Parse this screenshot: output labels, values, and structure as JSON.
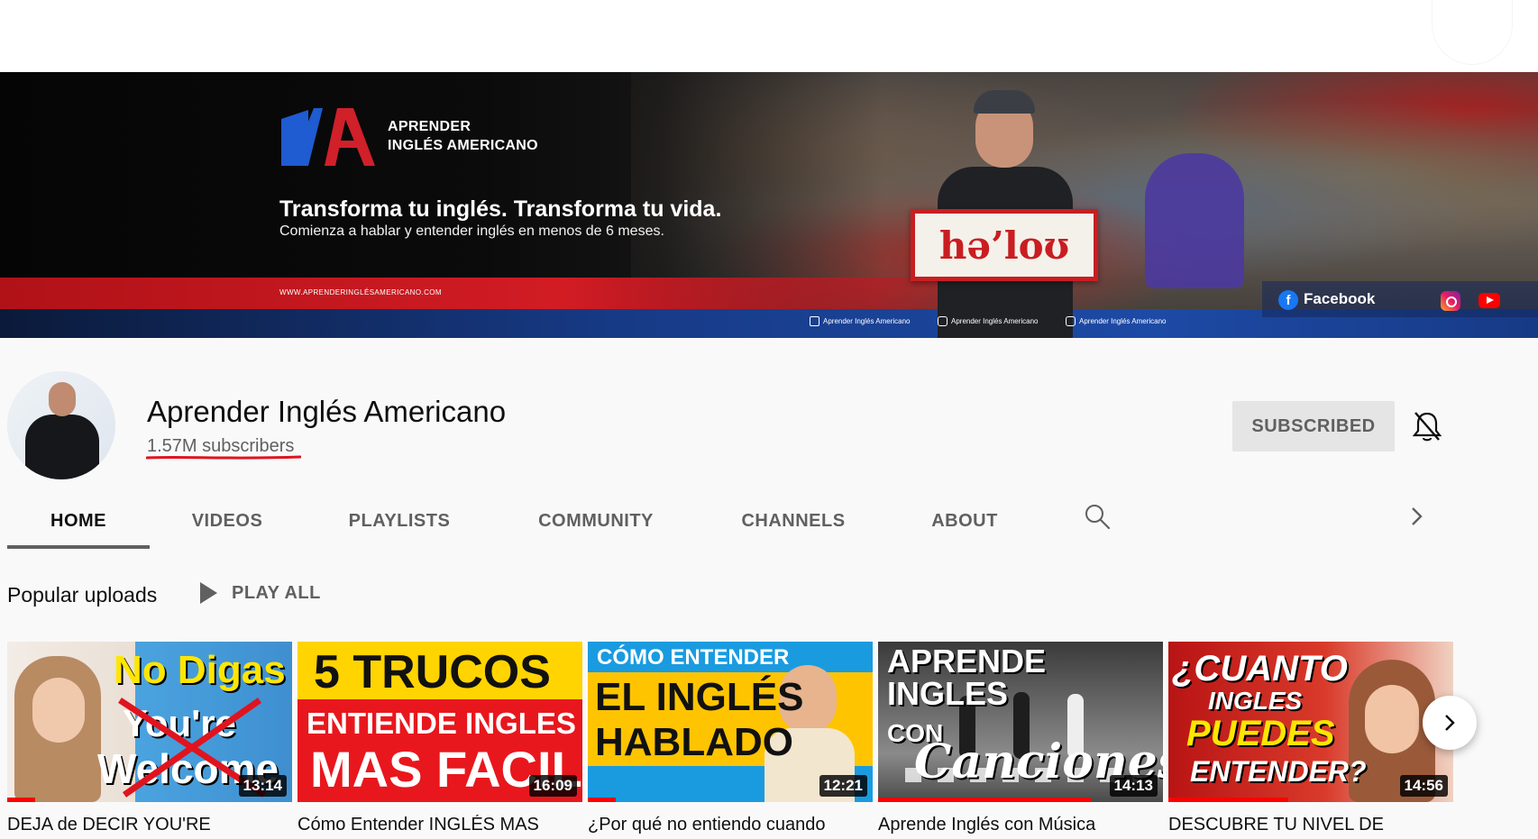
{
  "banner": {
    "logo_line1": "APRENDER",
    "logo_line2": "INGLÉS AMERICANO",
    "headline": "Transforma tu inglés. Transforma tu vida.",
    "subline": "Comienza a hablar y entender inglés en menos de 6 meses.",
    "url": "WWW.APRENDERINGLÉSAMERICANO.COM",
    "sign_text": "hə’loʊ",
    "social_links": [
      "Aprender Inglés Americano",
      "Aprender Inglés Americano",
      "Aprender Inglés Americano"
    ],
    "facebook_label": "Facebook"
  },
  "channel": {
    "name": "Aprender Inglés Americano",
    "subscribers": "1.57M subscribers",
    "subscribed_label": "SUBSCRIBED"
  },
  "tabs": [
    {
      "label": "HOME",
      "active": true
    },
    {
      "label": "VIDEOS"
    },
    {
      "label": "PLAYLISTS"
    },
    {
      "label": "COMMUNITY"
    },
    {
      "label": "CHANNELS"
    },
    {
      "label": "ABOUT"
    }
  ],
  "section": {
    "title": "Popular uploads",
    "play_all": "PLAY ALL"
  },
  "videos": [
    {
      "title": "DEJA de DECIR YOU'RE",
      "duration": "13:14",
      "thumb_lines": [
        "No Digas",
        "You're",
        "Welcome"
      ],
      "watched": 0.1
    },
    {
      "title": "Cómo Entender INGLÉS MAS",
      "duration": "16:09",
      "thumb_lines": [
        "5 TRUCOS",
        "ENTIENDE INGLES",
        "MAS FACIL"
      ],
      "watched": 0
    },
    {
      "title": "¿Por qué no entiendo cuando",
      "duration": "12:21",
      "thumb_lines": [
        "CÓMO ENTENDER",
        "EL INGLÉS",
        "HABLADO"
      ],
      "watched": 0.1
    },
    {
      "title": "Aprende Inglés con Música",
      "duration": "14:13",
      "thumb_lines": [
        "APRENDE INGLES",
        "CON",
        "Canciones"
      ],
      "watched": 0.75
    },
    {
      "title": "DESCUBRE TU NIVEL DE",
      "duration": "14:56",
      "thumb_lines": [
        "¿CUANTO",
        "INGLES",
        "PUEDES",
        "ENTENDER?"
      ],
      "watched": 0.42
    }
  ],
  "colors": {
    "accent_red": "#ff0000",
    "banner_red": "#c81e22",
    "banner_blue": "#173a86"
  },
  "icons": [
    "bell-off-icon",
    "search-icon",
    "chevron-right-icon",
    "play-icon",
    "facebook-icon",
    "instagram-icon",
    "youtube-icon"
  ]
}
